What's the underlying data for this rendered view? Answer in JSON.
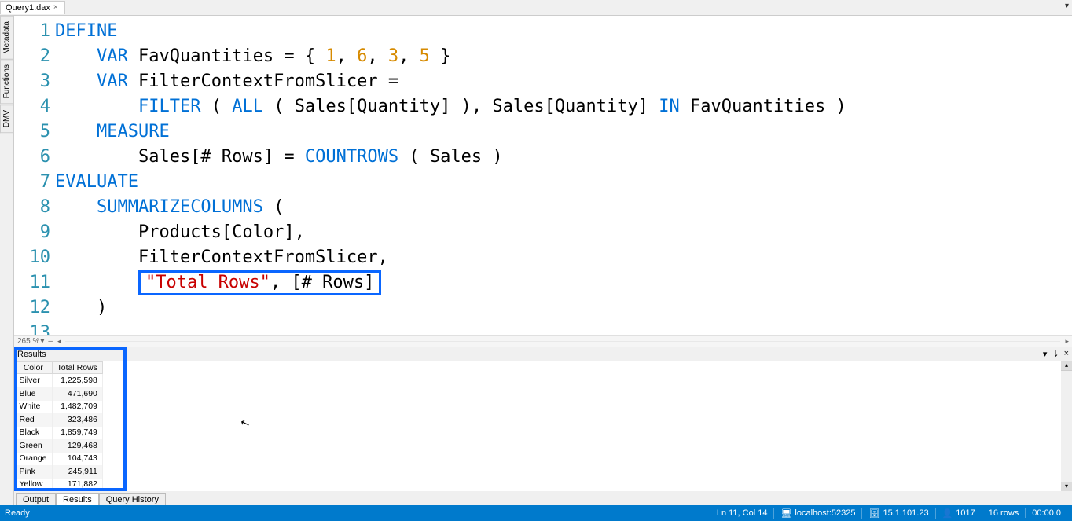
{
  "tabs": {
    "doc_name": "Query1.dax"
  },
  "side_tabs": [
    "Metadata",
    "Functions",
    "DMV"
  ],
  "editor": {
    "font_size": "22px",
    "lines": [
      {
        "n": 1,
        "tokens": [
          {
            "t": "DEFINE",
            "c": "kw"
          }
        ]
      },
      {
        "n": 2,
        "indent": 1,
        "tokens": [
          {
            "t": "VAR",
            "c": "kw"
          },
          {
            "t": " FavQuantities = { "
          },
          {
            "t": "1",
            "c": "num"
          },
          {
            "t": ", "
          },
          {
            "t": "6",
            "c": "num"
          },
          {
            "t": ", "
          },
          {
            "t": "3",
            "c": "num"
          },
          {
            "t": ", "
          },
          {
            "t": "5",
            "c": "num"
          },
          {
            "t": " }"
          }
        ]
      },
      {
        "n": 3,
        "indent": 1,
        "tokens": [
          {
            "t": "VAR",
            "c": "kw"
          },
          {
            "t": " FilterContextFromSlicer ="
          }
        ]
      },
      {
        "n": 4,
        "indent": 2,
        "tokens": [
          {
            "t": "FILTER",
            "c": "fn"
          },
          {
            "t": " ( "
          },
          {
            "t": "ALL",
            "c": "fn"
          },
          {
            "t": " ( Sales[Quantity] ), Sales[Quantity] "
          },
          {
            "t": "IN",
            "c": "kw"
          },
          {
            "t": " FavQuantities )"
          }
        ]
      },
      {
        "n": 5,
        "indent": 1,
        "tokens": [
          {
            "t": "MEASURE",
            "c": "kw"
          }
        ]
      },
      {
        "n": 6,
        "indent": 2,
        "tokens": [
          {
            "t": "Sales[# Rows] = "
          },
          {
            "t": "COUNTROWS",
            "c": "fn"
          },
          {
            "t": " ( Sales )"
          }
        ]
      },
      {
        "n": 7,
        "tokens": [
          {
            "t": "EVALUATE",
            "c": "kw"
          }
        ]
      },
      {
        "n": 8,
        "indent": 1,
        "tokens": [
          {
            "t": "SUMMARIZECOLUMNS",
            "c": "fn"
          },
          {
            "t": " ("
          }
        ]
      },
      {
        "n": 9,
        "indent": 2,
        "tokens": [
          {
            "t": "Products[Color],"
          }
        ]
      },
      {
        "n": 10,
        "indent": 2,
        "tokens": [
          {
            "t": "FilterContextFromSlicer,"
          }
        ]
      },
      {
        "n": 11,
        "indent": 2,
        "highlight": true,
        "tokens": [
          {
            "t": "\"Total Rows\"",
            "c": "str"
          },
          {
            "t": ", [# Rows]"
          }
        ]
      },
      {
        "n": 12,
        "indent": 1,
        "tokens": [
          {
            "t": ")"
          }
        ]
      },
      {
        "n": 13,
        "tokens": [
          {
            "t": ""
          }
        ]
      }
    ]
  },
  "zoom": {
    "pct": "265 %"
  },
  "results": {
    "title": "Results",
    "columns": [
      "Color",
      "Total Rows"
    ],
    "rows": [
      {
        "color": "Silver",
        "total": "1,225,598"
      },
      {
        "color": "Blue",
        "total": "471,690"
      },
      {
        "color": "White",
        "total": "1,482,709"
      },
      {
        "color": "Red",
        "total": "323,486"
      },
      {
        "color": "Black",
        "total": "1,859,749"
      },
      {
        "color": "Green",
        "total": "129,468"
      },
      {
        "color": "Orange",
        "total": "104,743"
      },
      {
        "color": "Pink",
        "total": "245,911"
      },
      {
        "color": "Yellow",
        "total": "171,882"
      }
    ]
  },
  "bottom_tabs": {
    "output": "Output",
    "results": "Results",
    "query_history": "Query History"
  },
  "status": {
    "ready": "Ready",
    "pos": "Ln 11, Col 14",
    "server": "localhost:52325",
    "ip": "15.1.101.23",
    "users": "1017",
    "rows": "16 rows",
    "time": "00:00.0"
  }
}
